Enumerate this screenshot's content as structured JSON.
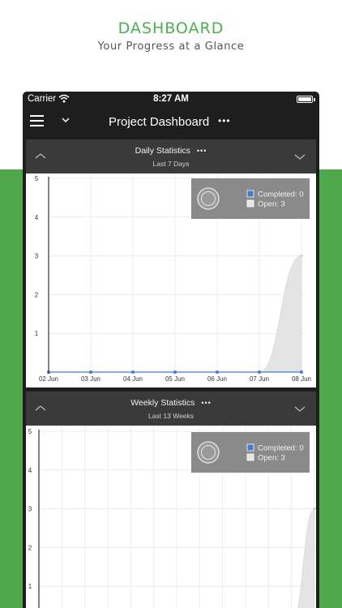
{
  "promo": {
    "title": "DASHBOARD",
    "subtitle": "Your Progress at a Glance",
    "accent_color": "#4CAF50",
    "band_color": "#4FA84A"
  },
  "status_bar": {
    "carrier": "Carrier",
    "time": "8:27 AM",
    "icons": [
      "wifi-icon",
      "battery-icon"
    ]
  },
  "nav": {
    "title": "Project Dashboard",
    "more_label": "•••",
    "icons": [
      "hamburger-menu-icon",
      "chevron-down-icon"
    ]
  },
  "panels": [
    {
      "title": "Daily Statistics",
      "more_label": "•••",
      "subtitle": "Last 7 Days",
      "legend": {
        "completed": "Completed: 0",
        "open": "Open: 3"
      },
      "chart_data": {
        "type": "area",
        "title": "Daily Statistics",
        "subtitle": "Last 7 Days",
        "x": [
          "02 Jun",
          "03 Jun",
          "04 Jun",
          "05 Jun",
          "06 Jun",
          "07 Jun",
          "08 Jun"
        ],
        "series": [
          {
            "name": "Completed",
            "values": [
              0,
              0,
              0,
              0,
              0,
              0,
              0
            ],
            "color": "#4a78c8"
          },
          {
            "name": "Open",
            "values": [
              0,
              0,
              0,
              0,
              0,
              0,
              3
            ],
            "color": "#e4e4e4"
          }
        ],
        "ylim": [
          0,
          5
        ],
        "y_ticks": [
          "5",
          "4",
          "3",
          "2",
          "1"
        ],
        "grid": true,
        "legend_position": "top-right"
      }
    },
    {
      "title": "Weekly Statistics",
      "more_label": "•••",
      "subtitle": "Last 13 Weeks",
      "legend": {
        "completed": "Completed: 0",
        "open": "Open: 3"
      },
      "chart_data": {
        "type": "area",
        "title": "Weekly Statistics",
        "subtitle": "Last 13 Weeks",
        "points": 13,
        "series": [
          {
            "name": "Completed",
            "values": [
              0,
              0,
              0,
              0,
              0,
              0,
              0,
              0,
              0,
              0,
              0,
              0,
              0
            ],
            "color": "#4a78c8"
          },
          {
            "name": "Open",
            "values": [
              0,
              0,
              0,
              0,
              0,
              0,
              0,
              0,
              0,
              0,
              0,
              0,
              3
            ],
            "color": "#e4e4e4"
          }
        ],
        "ylim": [
          0,
          5
        ],
        "y_ticks": [
          "5",
          "4",
          "3",
          "2",
          "1"
        ],
        "grid": true,
        "legend_position": "top-right"
      }
    }
  ]
}
